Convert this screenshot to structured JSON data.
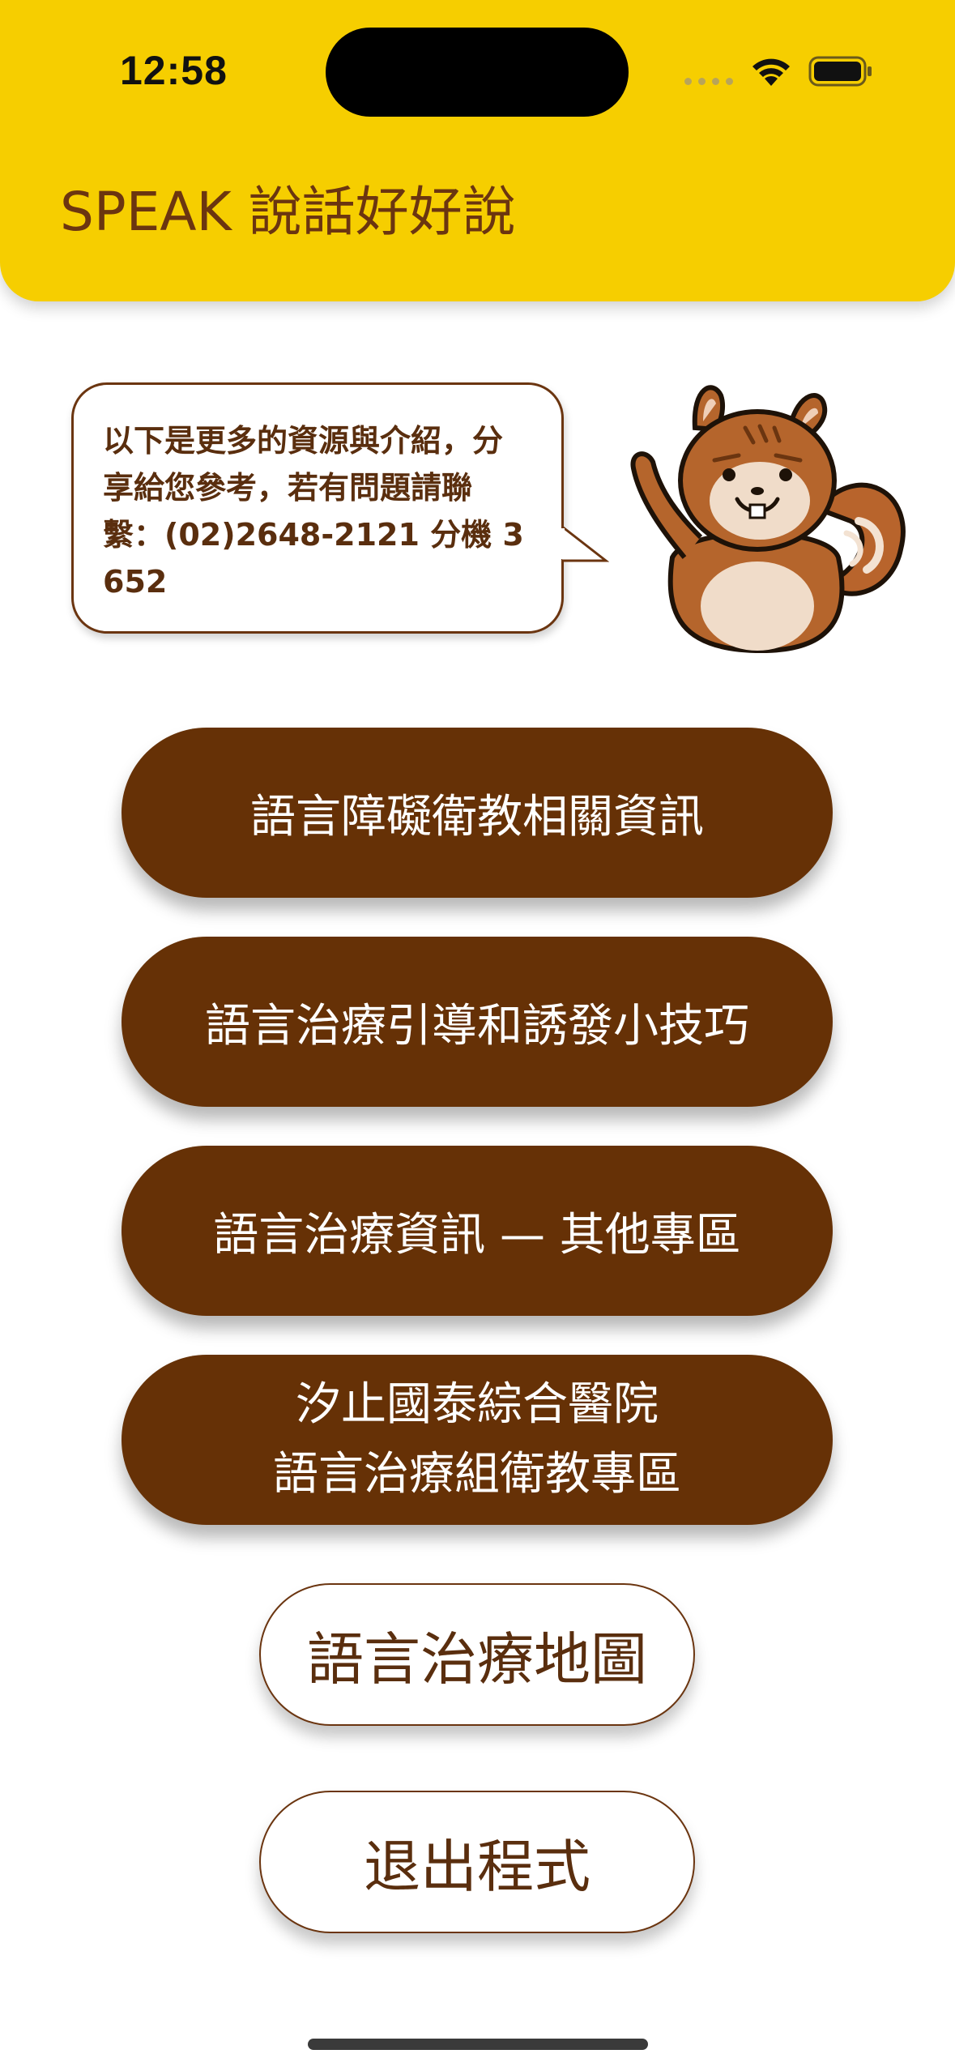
{
  "status_bar": {
    "time": "12:58"
  },
  "header": {
    "title": "SPEAK 說話好好說",
    "background_color": "#F6CE00",
    "title_color": "#6B3510"
  },
  "intro": {
    "message": "以下是更多的資源與介紹，分享給您參考，若有問題請聯繫：(02)2648-2121 分機 3652",
    "mascot": "squirrel-mascot"
  },
  "menu": {
    "button_color": "#663106",
    "items": [
      {
        "label": "語言障礙衛教相關資訊"
      },
      {
        "label": "語言治療引導和誘發小技巧"
      },
      {
        "label": "語言治療資訊 — 其他專區"
      },
      {
        "label_line1": "汐止國泰綜合醫院",
        "label_line2": "語言治療組衛教專區"
      }
    ],
    "map_button": "語言治療地圖",
    "exit_button": "退出程式"
  }
}
